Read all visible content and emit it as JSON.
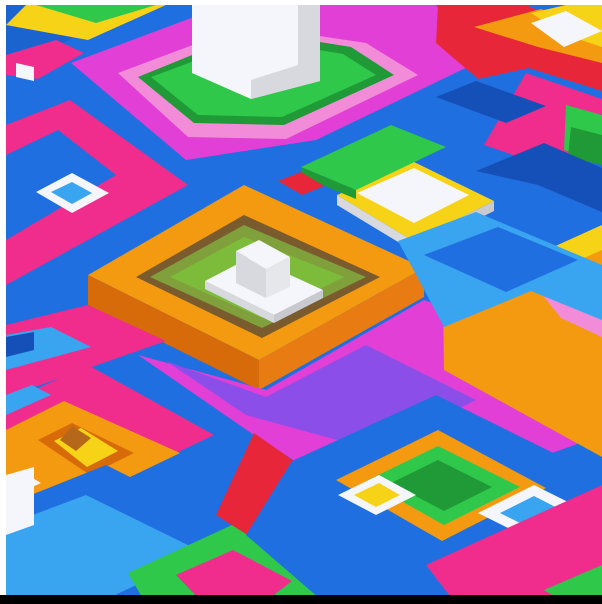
{
  "image": {
    "subject": "isometric-colorful-blocks"
  },
  "palette": {
    "blue": "#1f6fe0",
    "blue_light": "#39a4f0",
    "blue_dark": "#1550b8",
    "pink": "#f02c8d",
    "magenta": "#e23fd6",
    "orange": "#f39a11",
    "orange_dark": "#d86b09",
    "yellow": "#f7d317",
    "green": "#2fc84a",
    "green_dark": "#1f9a36",
    "red": "#e8263a",
    "purple": "#8b4ee8",
    "white": "#f4f6fb",
    "gray": "#d7d9df",
    "black": "#000000"
  }
}
